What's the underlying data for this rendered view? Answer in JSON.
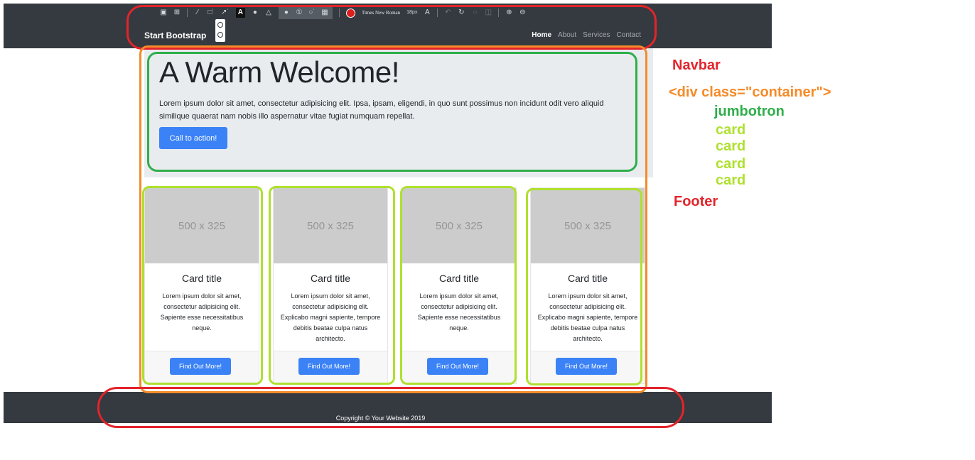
{
  "navbar": {
    "brand": "Start Bootstrap",
    "links": [
      {
        "label": "Home",
        "active": true
      },
      {
        "label": "About",
        "active": false
      },
      {
        "label": "Services",
        "active": false
      },
      {
        "label": "Contact",
        "active": false
      }
    ]
  },
  "toolbar": {
    "tools": [
      "screen-icon",
      "crop-icon",
      "line-icon",
      "rectangle-icon",
      "arrow-icon",
      "text-icon",
      "drop-icon",
      "shapes-icon",
      "speech-bubble-icon",
      "number-icon",
      "circle-icon",
      "image-icon",
      "color-picker-icon",
      "undo-icon",
      "redo-icon",
      "reset-icon",
      "trash-icon",
      "zoom-in-icon",
      "zoom-out-icon"
    ],
    "text_icon_glyph": "A",
    "font": "Times New Roman",
    "font_size": "18px",
    "font_style_glyph": "A",
    "color": "#dc1e1e"
  },
  "jumbotron": {
    "title": "A Warm Welcome!",
    "text": "Lorem ipsum dolor sit amet, consectetur adipisicing elit. Ipsa, ipsam, eligendi, in quo sunt possimus non incidunt odit vero aliquid similique quaerat nam nobis illo aspernatur vitae fugiat numquam repellat.",
    "button": "Call to action!"
  },
  "cards": [
    {
      "image": "500 x 325",
      "title": "Card title",
      "text": "Lorem ipsum dolor sit amet, consectetur adipisicing elit. Sapiente esse necessitatibus neque.",
      "button": "Find Out More!"
    },
    {
      "image": "500 x 325",
      "title": "Card title",
      "text": "Lorem ipsum dolor sit amet, consectetur adipisicing elit. Explicabo magni sapiente, tempore debitis beatae culpa natus architecto.",
      "button": "Find Out More!"
    },
    {
      "image": "500 x 325",
      "title": "Card title",
      "text": "Lorem ipsum dolor sit amet, consectetur adipisicing elit. Sapiente esse necessitatibus neque.",
      "button": "Find Out More!"
    },
    {
      "image": "500 x 325",
      "title": "Card title",
      "text": "Lorem ipsum dolor sit amet, consectetur adipisicing elit. Explicabo magni sapiente, tempore debitis beatae culpa natus architecto.",
      "button": "Find Out More!"
    }
  ],
  "footer": {
    "copyright": "Copyright © Your Website 2019"
  },
  "legend": {
    "navbar": "Navbar",
    "container": "<div class=\"container\">",
    "jumbotron": "jumbotron",
    "cards": [
      "card",
      "card",
      "card",
      "card"
    ],
    "footer": "Footer"
  },
  "colors": {
    "navbar_annotation": "#e3242b",
    "container_annotation": "#f58b2a",
    "jumbotron_annotation": "#2fae4a",
    "card_annotation": "#afe02f",
    "footer_annotation": "#e3242b",
    "primary_button": "#3b82f6",
    "dark_bar": "#343a40"
  }
}
